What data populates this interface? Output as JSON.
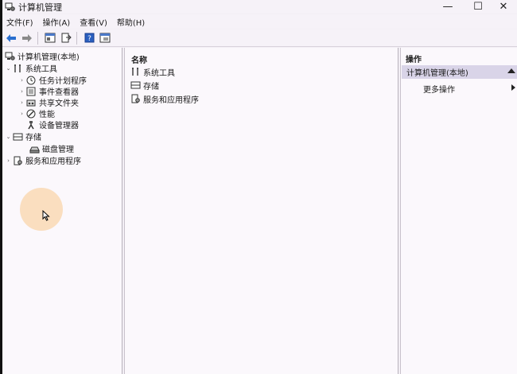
{
  "window": {
    "title": "计算机管理",
    "controls": {
      "minimize": "—",
      "maximize": "☐",
      "close": "✕"
    }
  },
  "menu": [
    "文件(F)",
    "操作(A)",
    "查看(V)",
    "帮助(H)"
  ],
  "toolbar": {
    "buttons": [
      "back-arrow-icon",
      "forward-arrow-icon",
      "console-icon",
      "export-icon",
      "help-icon",
      "properties-icon"
    ]
  },
  "tree": {
    "root": "计算机管理(本地)",
    "system_tools": "系统工具",
    "task_scheduler": "任务计划程序",
    "event_viewer": "事件查看器",
    "shared_folders": "共享文件夹",
    "performance": "性能",
    "device_manager": "设备管理器",
    "storage": "存储",
    "disk_management": "磁盘管理",
    "services_apps": "服务和应用程序"
  },
  "center": {
    "column_header": "名称",
    "items": [
      "系统工具",
      "存储",
      "服务和应用程序"
    ]
  },
  "actions": {
    "header": "操作",
    "section": "计算机管理(本地)",
    "more": "更多操作"
  },
  "colors": {
    "background": "#f3eff5",
    "pane": "#fbf8fc",
    "actions_band": "#d9d4e8",
    "click_highlight": "#fac88c"
  }
}
